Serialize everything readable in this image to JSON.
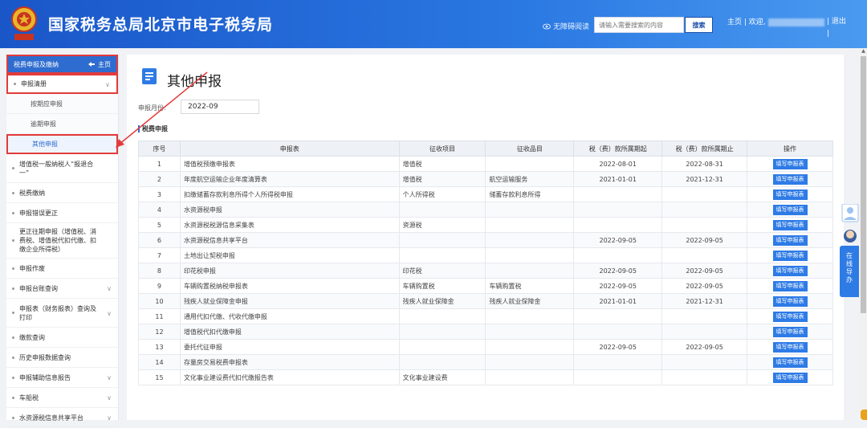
{
  "header": {
    "title": "国家税务总局北京市电子税务局",
    "accessibility_label": "无障碍阅读",
    "search_placeholder": "请输入需要搜索的内容",
    "search_button": "搜索",
    "home_link": "主页",
    "welcome": "欢迎,",
    "logout": "退出"
  },
  "sidebar": {
    "section": "税费申报及缴纳",
    "home_label": "主页",
    "items": [
      {
        "label": "申报清册"
      },
      {
        "label": "按期应申报"
      },
      {
        "label": "逾期申报"
      },
      {
        "label": "其他申报"
      },
      {
        "label": "增值税一般纳税人“报退合一”"
      },
      {
        "label": "税费缴纳"
      },
      {
        "label": "申报错误更正"
      },
      {
        "label": "更正往期申报（增值税、消费税、增值税代扣代缴、扣缴企业所得税）"
      },
      {
        "label": "申报作废"
      },
      {
        "label": "申报台账查询"
      },
      {
        "label": "申报表（财务报表）查询及打印"
      },
      {
        "label": "缴款查询"
      },
      {
        "label": "历史申报数据查询"
      },
      {
        "label": "申报辅助信息报告"
      },
      {
        "label": "车船税"
      },
      {
        "label": "水资源税信息共享平台"
      }
    ]
  },
  "main": {
    "title": "其他申报",
    "period_label": "申报月份:",
    "period_value": "2022-09",
    "section_title": "税费申报",
    "columns": [
      "序号",
      "申报表",
      "征收项目",
      "征收品目",
      "税（费）款所属期起",
      "税（费）款所属期止",
      "操作"
    ],
    "rows": [
      {
        "no": "1",
        "form": "增值税预缴申报表",
        "item": "增值税",
        "sub": "",
        "start": "2022-08-01",
        "end": "2022-08-31",
        "op": "填写申报表"
      },
      {
        "no": "2",
        "form": "年度航空运输企业年度清算表",
        "item": "增值税",
        "sub": "航空运输服务",
        "start": "2021-01-01",
        "end": "2021-12-31",
        "op": "填写申报表"
      },
      {
        "no": "3",
        "form": "扣缴储蓄存款利息所得个人所得税申报",
        "item": "个人所得税",
        "sub": "储蓄存款利息所得",
        "start": "",
        "end": "",
        "op": "填写申报表"
      },
      {
        "no": "4",
        "form": "水资源税申报",
        "item": "",
        "sub": "",
        "start": "",
        "end": "",
        "op": "填写申报表"
      },
      {
        "no": "5",
        "form": "水资源税税源信息采集表",
        "item": "资源税",
        "sub": "",
        "start": "",
        "end": "",
        "op": "填写申报表"
      },
      {
        "no": "6",
        "form": "水资源税信息共享平台",
        "item": "",
        "sub": "",
        "start": "2022-09-05",
        "end": "2022-09-05",
        "op": "填写申报表"
      },
      {
        "no": "7",
        "form": "土地出让契税申报",
        "item": "",
        "sub": "",
        "start": "",
        "end": "",
        "op": "填写申报表"
      },
      {
        "no": "8",
        "form": "印花税申报",
        "item": "印花税",
        "sub": "",
        "start": "2022-09-05",
        "end": "2022-09-05",
        "op": "填写申报表"
      },
      {
        "no": "9",
        "form": "车辆购置税纳税申报表",
        "item": "车辆购置税",
        "sub": "车辆购置税",
        "start": "2022-09-05",
        "end": "2022-09-05",
        "op": "填写申报表"
      },
      {
        "no": "10",
        "form": "残疾人就业保障金申报",
        "item": "残疾人就业保障金",
        "sub": "残疾人就业保障金",
        "start": "2021-01-01",
        "end": "2021-12-31",
        "op": "填写申报表"
      },
      {
        "no": "11",
        "form": "通用代扣代缴、代收代缴申报",
        "item": "",
        "sub": "",
        "start": "",
        "end": "",
        "op": "填写申报表"
      },
      {
        "no": "12",
        "form": "增值税代扣代缴申报",
        "item": "",
        "sub": "",
        "start": "",
        "end": "",
        "op": "填写申报表"
      },
      {
        "no": "13",
        "form": "委托代征申报",
        "item": "",
        "sub": "",
        "start": "2022-09-05",
        "end": "2022-09-05",
        "op": "填写申报表"
      },
      {
        "no": "14",
        "form": "存量房交易税费申报表",
        "item": "",
        "sub": "",
        "start": "",
        "end": "",
        "op": "填写申报表"
      },
      {
        "no": "15",
        "form": "文化事业建设费代扣代缴报告表",
        "item": "文化事业建设费",
        "sub": "",
        "start": "",
        "end": "",
        "op": "填写申报表"
      }
    ]
  },
  "float": {
    "online_guide": "在线导办"
  },
  "colors": {
    "header_blue": "#2a78e2",
    "accent_blue": "#2e7be6",
    "highlight_red": "#e23b3b"
  }
}
